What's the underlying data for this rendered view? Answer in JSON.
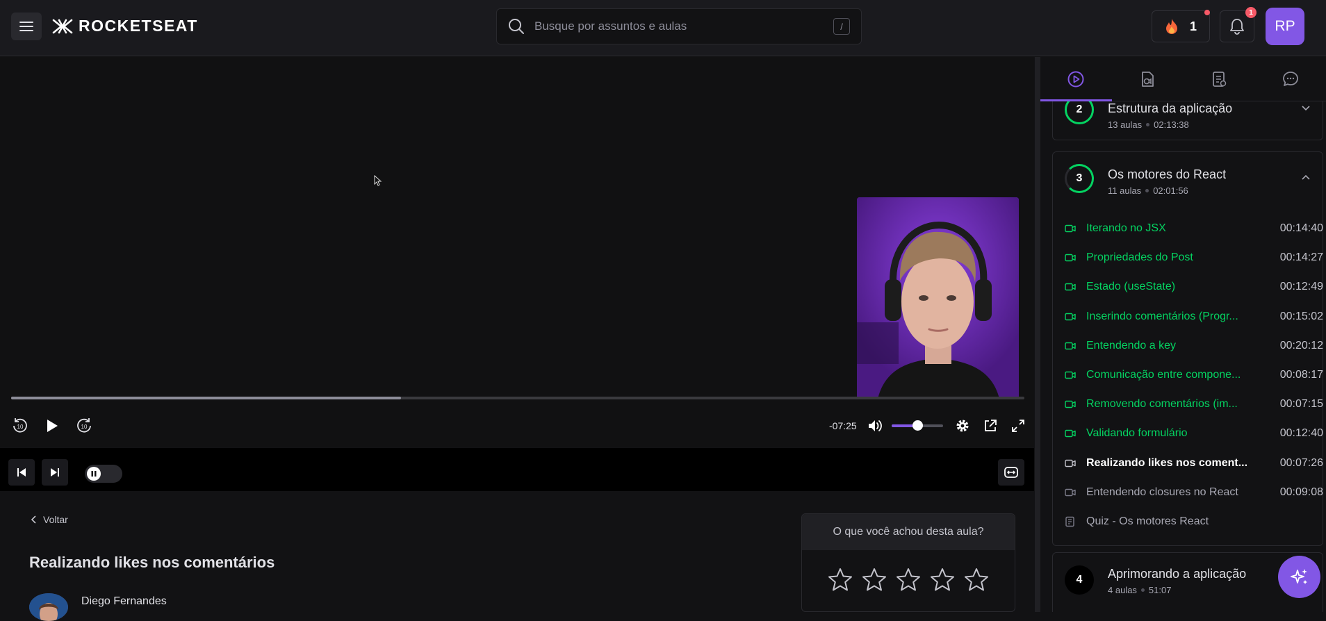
{
  "header": {
    "logo_text": "ROCKETSEAT",
    "search_placeholder": "Busque por assuntos e aulas",
    "search_shortcut": "/",
    "streak_count": "1",
    "notification_count": "1",
    "user_initials": "RP"
  },
  "player": {
    "time_remaining": "-07:25",
    "progress_fraction": 0.385,
    "volume_fraction": 0.5,
    "skip_back_label": "10",
    "skip_forward_label": "10",
    "autoplay_on": false
  },
  "lesson": {
    "back_label": "Voltar",
    "title": "Realizando likes nos comentários",
    "author": "Diego Fernandes",
    "rating_question": "O que você achou desta aula?",
    "stars": 5
  },
  "sidebar": {
    "modules": [
      {
        "number": "2",
        "title": "Estrutura da aplicação",
        "lessons_count": "13 aulas",
        "duration": "02:13:38",
        "expanded": false
      },
      {
        "number": "3",
        "title": "Os motores do React",
        "lessons_count": "11 aulas",
        "duration": "02:01:56",
        "expanded": true
      },
      {
        "number": "4",
        "title": "Aprimorando a aplicação",
        "lessons_count": "4 aulas",
        "duration": "51:07",
        "expanded": false
      }
    ],
    "lessons": [
      {
        "title": "Iterando no JSX",
        "duration": "00:14:40",
        "state": "done",
        "kind": "video"
      },
      {
        "title": "Propriedades do Post",
        "duration": "00:14:27",
        "state": "done",
        "kind": "video"
      },
      {
        "title": "Estado (useState)",
        "duration": "00:12:49",
        "state": "done",
        "kind": "video"
      },
      {
        "title": "Inserindo comentários (Progr...",
        "duration": "00:15:02",
        "state": "done",
        "kind": "video"
      },
      {
        "title": "Entendendo a key",
        "duration": "00:20:12",
        "state": "done",
        "kind": "video"
      },
      {
        "title": "Comunicação entre compone...",
        "duration": "00:08:17",
        "state": "done",
        "kind": "video"
      },
      {
        "title": "Removendo comentários (im...",
        "duration": "00:07:15",
        "state": "done",
        "kind": "video"
      },
      {
        "title": "Validando formulário",
        "duration": "00:12:40",
        "state": "done",
        "kind": "video"
      },
      {
        "title": "Realizando likes nos coment...",
        "duration": "00:07:26",
        "state": "current",
        "kind": "video"
      },
      {
        "title": "Entendendo closures no React",
        "duration": "00:09:08",
        "state": "pending",
        "kind": "video"
      },
      {
        "title": "Quiz - Os motores React",
        "duration": "",
        "state": "pending",
        "kind": "quiz"
      }
    ]
  },
  "colors": {
    "accent": "#8257e5",
    "success": "#04d361",
    "alert": "#f75a68"
  }
}
